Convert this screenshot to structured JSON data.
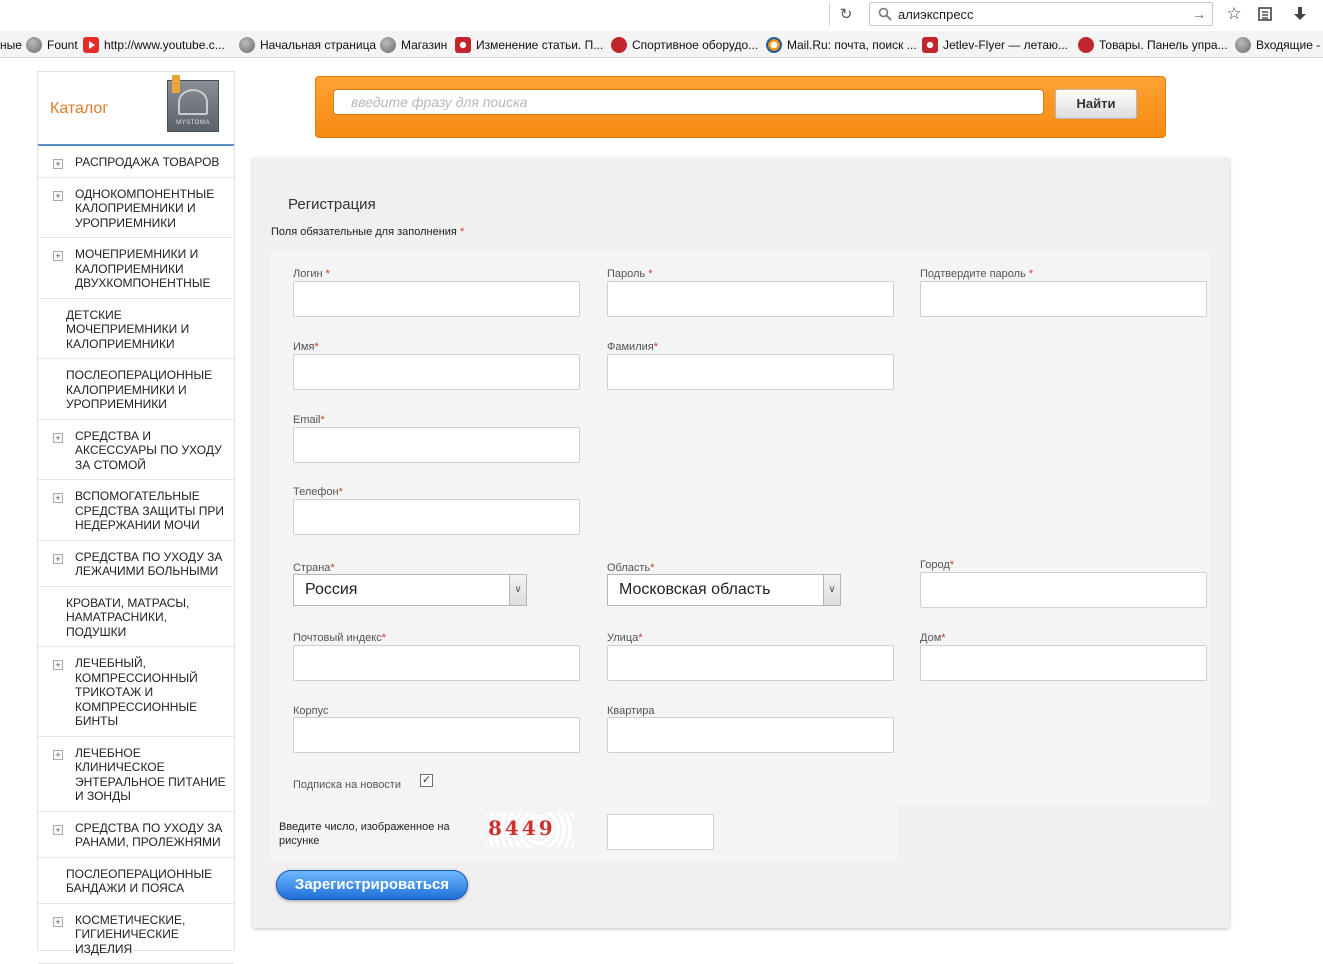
{
  "browser": {
    "search_text": "алиэкспресс",
    "bookmarks": [
      {
        "label": "ные",
        "icon": "none"
      },
      {
        "label": "Fount",
        "icon": "globe-icon"
      },
      {
        "label": "http://www.youtube.c...",
        "icon": "youtube-icon"
      },
      {
        "label": "Начальная страница",
        "icon": "globe-icon"
      },
      {
        "label": "Магазин",
        "icon": "globe-icon"
      },
      {
        "label": "Изменение статьи. П...",
        "icon": "site-icon"
      },
      {
        "label": "Спортивное оборудо...",
        "icon": "star-icon"
      },
      {
        "label": "Mail.Ru: почта, поиск ...",
        "icon": "mail-icon"
      },
      {
        "label": "Jetlev-Flyer — летаю...",
        "icon": "site-icon"
      },
      {
        "label": "Товары. Панель упра...",
        "icon": "star-icon"
      },
      {
        "label": "Входящие -",
        "icon": "globe-icon"
      }
    ]
  },
  "sidebar": {
    "title": "Каталог",
    "logo_text": "MYSTOMA",
    "items": [
      {
        "label": "РАСПРОДАЖА ТОВАРОВ",
        "expandable": true
      },
      {
        "label": "ОДНОКОМПОНЕНТНЫЕ КАЛОПРИЕМНИКИ И УРОПРИЕМНИКИ",
        "expandable": true
      },
      {
        "label": "МОЧЕПРИЕМНИКИ И КАЛОПРИЕМНИКИ ДВУХКОМПОНЕНТНЫЕ",
        "expandable": true
      },
      {
        "label": "ДЕТСКИЕ МОЧЕПРИЕМНИКИ И КАЛОПРИЕМНИКИ",
        "expandable": false
      },
      {
        "label": "ПОСЛЕОПЕРАЦИОННЫЕ КАЛОПРИЕМНИКИ И УРОПРИЕМНИКИ",
        "expandable": false
      },
      {
        "label": "СРЕДСТВА И АКСЕССУАРЫ ПО УХОДУ ЗА СТОМОЙ",
        "expandable": true
      },
      {
        "label": "ВСПОМОГАТЕЛЬНЫЕ СРЕДСТВА ЗАЩИТЫ ПРИ НЕДЕРЖАНИИ МОЧИ",
        "expandable": true
      },
      {
        "label": "СРЕДСТВА ПО УХОДУ ЗА ЛЕЖАЧИМИ БОЛЬНЫМИ",
        "expandable": true
      },
      {
        "label": "КРОВАТИ, МАТРАСЫ, НАМАТРАСНИКИ, ПОДУШКИ",
        "expandable": false
      },
      {
        "label": "ЛЕЧЕБНЫЙ, КОМПРЕССИОННЫЙ ТРИКОТАЖ И КОМПРЕССИОННЫЕ БИНТЫ",
        "expandable": true
      },
      {
        "label": "ЛЕЧЕБНОЕ КЛИНИЧЕСКОЕ ЭНТЕРАЛЬНОЕ ПИТАНИЕ И ЗОНДЫ",
        "expandable": true
      },
      {
        "label": "СРЕДСТВА ПО УХОДУ ЗА РАНАМИ, ПРОЛЕЖНЯМИ",
        "expandable": true
      },
      {
        "label": "ПОСЛЕОПЕРАЦИОННЫЕ БАНДАЖИ И ПОЯСА",
        "expandable": false
      },
      {
        "label": "КОСМЕТИЧЕСКИЕ, ГИГИЕНИЧЕСКИЕ ИЗДЕЛИЯ",
        "expandable": true
      }
    ]
  },
  "site_search": {
    "placeholder": "введите фразу для поиска",
    "button": "Найти"
  },
  "registration": {
    "title": "Регистрация",
    "required_note": "Поля обязательные для заполнения",
    "fields": {
      "login": "Логин",
      "password": "Пароль",
      "confirm_password": "Подтвердите пароль",
      "first_name": "Имя",
      "last_name": "Фамилия",
      "email": "Email",
      "phone": "Телефон",
      "country": "Страна",
      "region": "Область",
      "city": "Город",
      "postcode": "Почтовый индекс",
      "street": "Улица",
      "house": "Дом",
      "building": "Корпус",
      "apartment": "Квартира"
    },
    "country_value": "Россия",
    "region_value": "Московская область",
    "newsletter_label": "Подписка на новости",
    "newsletter_checked": true,
    "captcha_label": "Введите число, изображенное на рисунке",
    "captcha_text": "8449",
    "submit": "Зарегистрироваться"
  }
}
